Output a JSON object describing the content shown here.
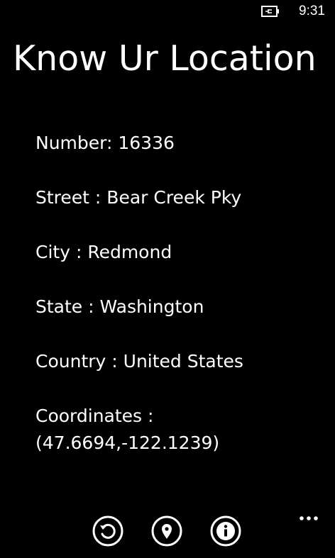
{
  "status_bar": {
    "battery_icon": "battery-charging-icon",
    "time": "9:31"
  },
  "app": {
    "title": "Know Ur Location"
  },
  "location": {
    "number_label": "Number:",
    "number_value": "16336",
    "street_label": "Street :",
    "street_value": "Bear Creek Pky",
    "city_label": "City :",
    "city_value": "Redmond",
    "state_label": "State :",
    "state_value": "Washington",
    "country_label": "Country :",
    "country_value": "United States",
    "coordinates_label": "Coordinates :",
    "coordinates_value": "(47.6694,-122.1239)"
  },
  "app_bar": {
    "buttons": [
      {
        "icon": "refresh-icon"
      },
      {
        "icon": "map-pin-icon"
      },
      {
        "icon": "info-icon"
      }
    ],
    "more_icon": "more-ellipsis-icon"
  },
  "colors": {
    "background": "#000000",
    "foreground": "#ffffff"
  }
}
